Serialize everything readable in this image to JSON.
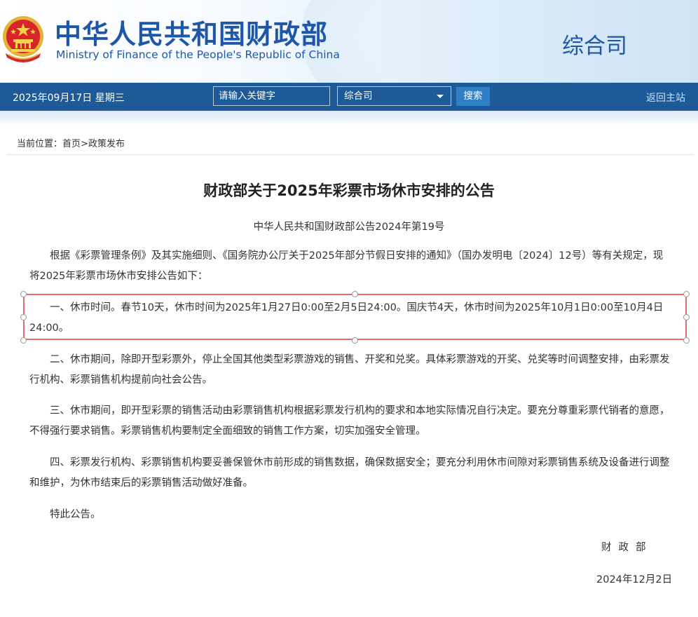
{
  "header": {
    "title_cn": "中华人民共和国财政部",
    "title_en": "Ministry of Finance of the People's Republic of China",
    "department": "综合司"
  },
  "toolbar": {
    "date": "2025年09月17日  星期三",
    "search_placeholder": "请输入关键字",
    "select_value": "综合司",
    "search_button": "搜索",
    "home_link": "返回主站"
  },
  "breadcrumb": {
    "prefix": "当前位置：",
    "home": "首页",
    "separator": ">",
    "current": "政策发布"
  },
  "article": {
    "title": "财政部关于2025年彩票市场休市安排的公告",
    "doc_number": "中华人民共和国财政部公告2024年第19号",
    "paragraphs": [
      "根据《彩票管理条例》及其实施细则、《国务院办公厅关于2025年部分节假日安排的通知》（国办发明电〔2024〕12号）等有关规定，现将2025年彩票市场休市安排公告如下：",
      "一、休市时间。春节10天，休市时间为2025年1月27日0:00至2月5日24:00。国庆节4天，休市时间为2025年10月1日0:00至10月4日24:00。",
      "二、休市期间，除即开型彩票外，停止全国其他类型彩票游戏的销售、开奖和兑奖。具体彩票游戏的开奖、兑奖等时间调整安排，由彩票发行机构、彩票销售机构提前向社会公告。",
      "三、休市期间，即开型彩票的销售活动由彩票销售机构根据彩票发行机构的要求和本地实际情况自行决定。要充分尊重彩票代销者的意愿，不得强行要求销售。彩票销售机构要制定全面细致的销售工作方案，切实加强安全管理。",
      "四、彩票发行机构、彩票销售机构要妥善保管休市前形成的销售数据，确保数据安全；要充分利用休市间隙对彩票销售系统及设备进行调整和维护，为休市结束后的彩票销售活动做好准备。",
      "特此公告。"
    ],
    "signature": "财政部",
    "date": "2024年12月2日"
  },
  "colors": {
    "brand_blue": "#1e57a8",
    "toolbar_bg": "#1d5a97",
    "selection_border": "#e06c6c"
  }
}
